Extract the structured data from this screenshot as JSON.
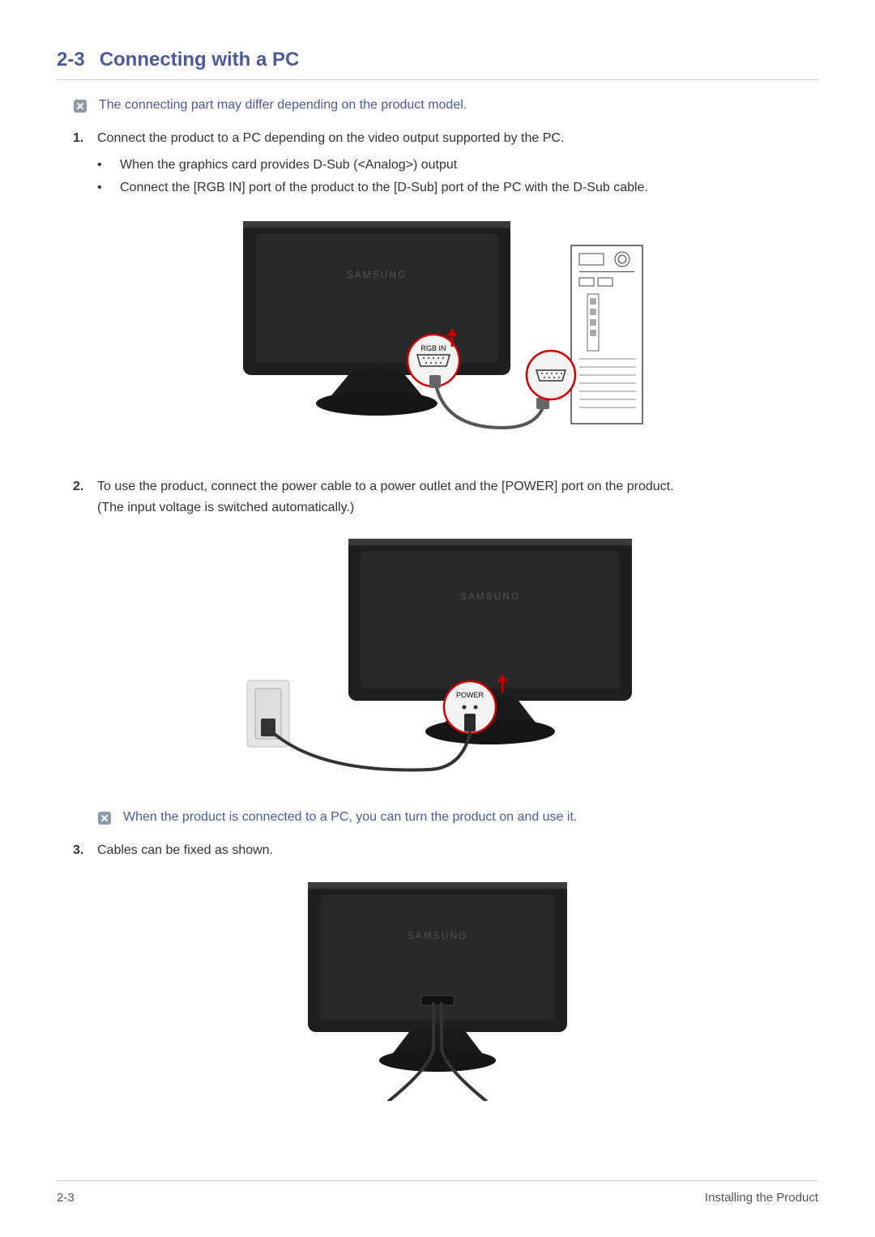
{
  "heading": {
    "number": "2-3",
    "title": "Connecting with a PC"
  },
  "note1": "The connecting part may differ depending on the product model.",
  "steps": {
    "s1_num": "1.",
    "s1_text": "Connect the product to a PC depending on the video output supported by the PC.",
    "s1_bullets": [
      "When the graphics card provides D-Sub (<Analog>) output",
      "Connect the [RGB IN] port of the product to the [D-Sub] port of the PC with the D-Sub cable."
    ],
    "s2_num": "2.",
    "s2_text": "To use the product, connect the power cable to a power outlet and the [POWER] port on the product.",
    "s2_text2": "(The input voltage is switched automatically.)",
    "s3_num": "3.",
    "s3_text": "Cables can be fixed as shown."
  },
  "note2": "When the product is connected to a PC, you can turn the product on and use it.",
  "fig1_label_rgb": "RGB IN",
  "fig2_label_power": "POWER",
  "brand_label": "SAMSUNG",
  "footer": {
    "left": "2-3",
    "right": "Installing the Product"
  }
}
